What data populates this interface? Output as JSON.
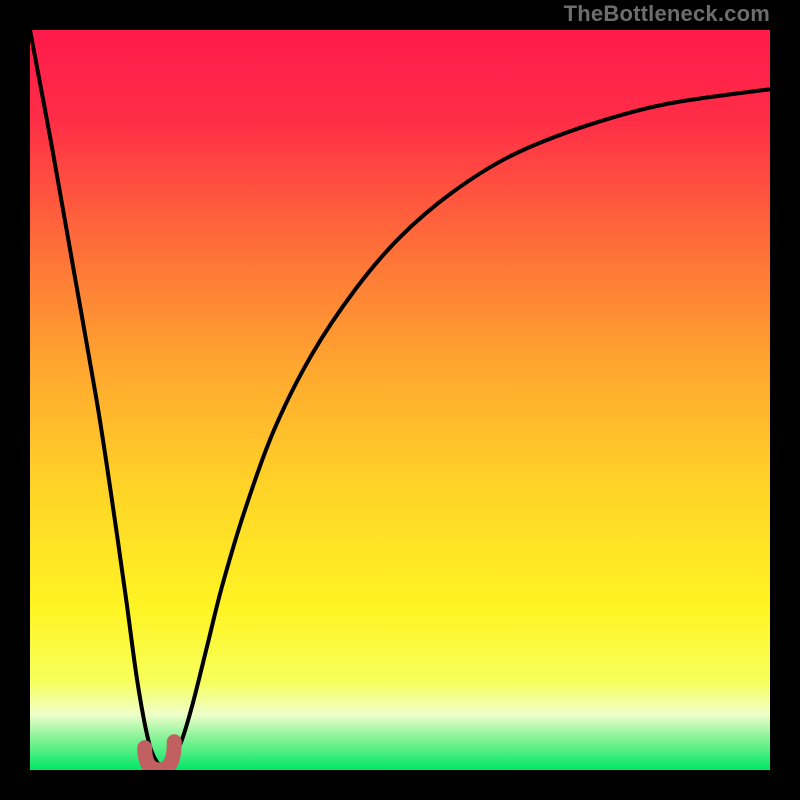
{
  "watermark": "TheBottleneck.com",
  "colors": {
    "frame": "#000000",
    "gradient_stops": [
      {
        "offset": 0.0,
        "color": "#ff1a4b"
      },
      {
        "offset": 0.12,
        "color": "#ff2d47"
      },
      {
        "offset": 0.28,
        "color": "#ff6a3a"
      },
      {
        "offset": 0.45,
        "color": "#ffa52f"
      },
      {
        "offset": 0.62,
        "color": "#ffd427"
      },
      {
        "offset": 0.78,
        "color": "#fff423"
      },
      {
        "offset": 0.88,
        "color": "#f7ff5b"
      },
      {
        "offset": 0.925,
        "color": "#efffca"
      },
      {
        "offset": 0.955,
        "color": "#8cf39a"
      },
      {
        "offset": 1.0,
        "color": "#00e765"
      }
    ],
    "curve": "#000000",
    "dot": "#c06060"
  },
  "chart_data": {
    "type": "line",
    "title": "",
    "xlabel": "",
    "ylabel": "",
    "xlim": [
      0,
      100
    ],
    "ylim": [
      0,
      100
    ],
    "series": [
      {
        "name": "bottleneck-curve",
        "x": [
          0,
          3,
          6,
          9,
          11,
          13,
          14.5,
          16,
          17.2,
          18.2,
          19.2,
          20.5,
          22,
          24,
          26,
          29,
          33,
          38,
          44,
          50,
          57,
          65,
          75,
          86,
          100
        ],
        "y": [
          100,
          84,
          67,
          50,
          37,
          23,
          12,
          4,
          1,
          0.5,
          1.5,
          4,
          9,
          17,
          25,
          35,
          46,
          56,
          65,
          72,
          78,
          83,
          87,
          90,
          92
        ]
      }
    ],
    "annotations": [
      {
        "name": "optimal-dot",
        "x_range": [
          15.5,
          19.5
        ],
        "y_range": [
          0,
          3
        ]
      }
    ]
  }
}
